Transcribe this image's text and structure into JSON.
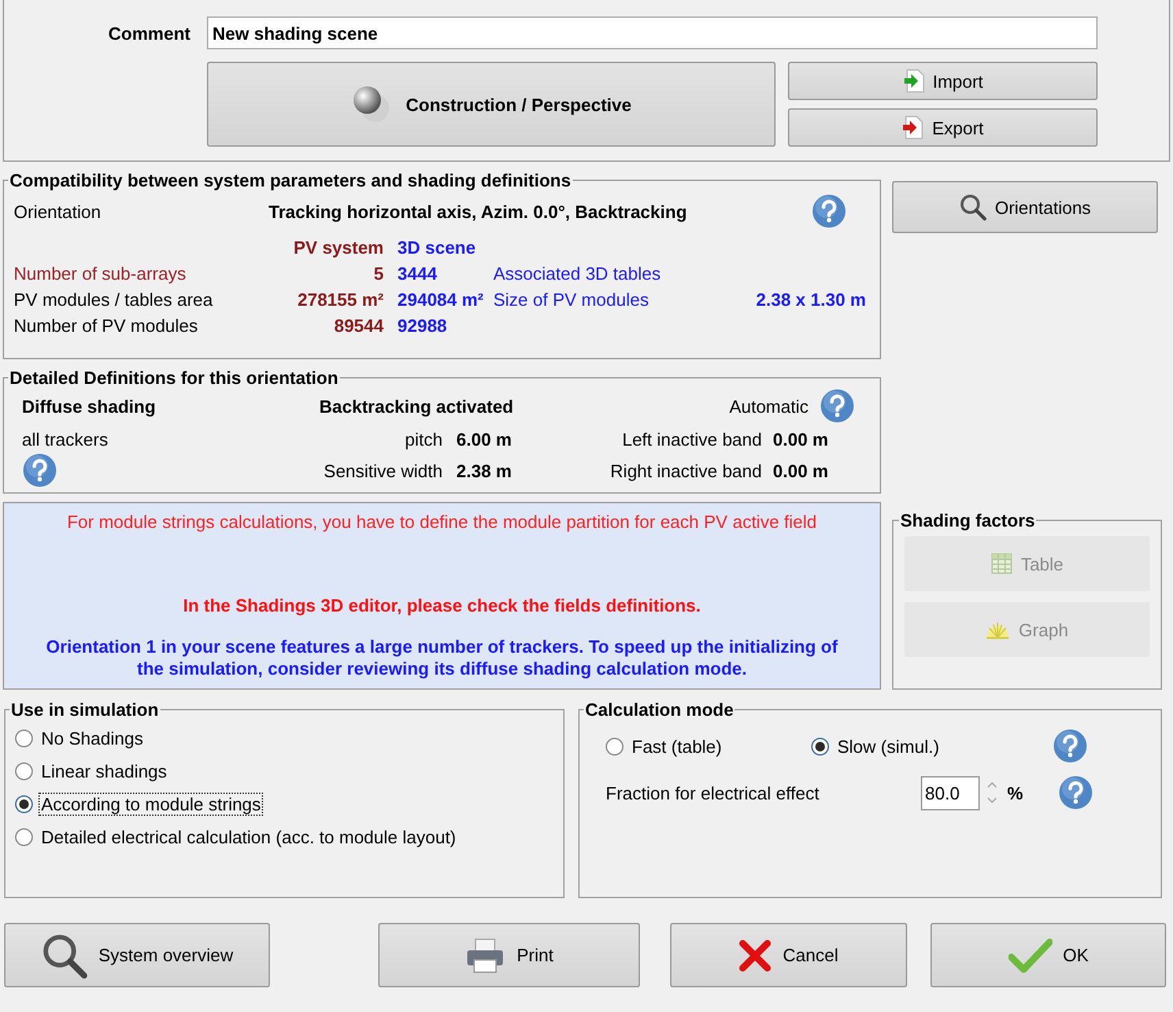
{
  "comment": {
    "label": "Comment",
    "value": "New shading scene"
  },
  "top_buttons": {
    "construction": "Construction / Perspective",
    "import": "Import",
    "export": "Export"
  },
  "compatibility": {
    "title": "Compatibility between system parameters and shading definitions",
    "orientation_label": "Orientation",
    "orientation_value": "Tracking horizontal axis, Azim. 0.0°, Backtracking",
    "col_pv": "PV system",
    "col_3d": "3D scene",
    "rows": [
      {
        "label": "Number of sub-arrays",
        "color": "#9b2226",
        "pv": "5",
        "scene": "3444",
        "extra_label": "Associated 3D tables",
        "extra_value": ""
      },
      {
        "label": "PV modules / tables area",
        "color": "#000000",
        "pv": "278155 m²",
        "scene": "294084 m²",
        "extra_label": "Size of PV modules",
        "extra_value": "2.38 x 1.30 m"
      },
      {
        "label": "Number of PV modules",
        "color": "#000000",
        "pv": "89544",
        "scene": "92988",
        "extra_label": "",
        "extra_value": ""
      }
    ]
  },
  "orientations_button": "Orientations",
  "detailed": {
    "title": "Detailed Definitions for this orientation",
    "diffuse_title": "Diffuse shading",
    "diffuse_value": "all trackers",
    "backtracking": "Backtracking activated",
    "automatic": "Automatic",
    "params": [
      {
        "label": "pitch",
        "value": "6.00 m",
        "label2": "Left inactive band",
        "value2": "0.00 m"
      },
      {
        "label": "Sensitive width",
        "value": "2.38 m",
        "label2": "Right inactive band",
        "value2": "0.00 m"
      }
    ]
  },
  "messages": [
    {
      "kind": "note",
      "text": "For module strings calculations, you have to define the module partition for each PV active field"
    },
    {
      "kind": "warning",
      "text": "In the Shadings 3D editor, please check the fields definitions."
    },
    {
      "kind": "advice",
      "text": "Orientation 1 in your scene features a large number of trackers. To speed up the initializing of the simulation, consider reviewing its diffuse shading calculation mode."
    }
  ],
  "shading_factors": {
    "title": "Shading factors",
    "buttons": [
      {
        "kind": "table",
        "label": "Table",
        "disabled": true
      },
      {
        "kind": "graph",
        "label": "Graph",
        "disabled": true
      }
    ]
  },
  "use_in_simulation": {
    "title": "Use in simulation",
    "options": [
      {
        "label": "No Shadings",
        "selected": false,
        "focused": false
      },
      {
        "label": "Linear shadings",
        "selected": false,
        "focused": false
      },
      {
        "label": "According to module strings",
        "selected": true,
        "focused": true
      },
      {
        "label": "Detailed electrical calculation (acc. to module layout)",
        "selected": false,
        "focused": false
      }
    ]
  },
  "calculation_mode": {
    "title": "Calculation mode",
    "options": [
      {
        "label": "Fast (table)",
        "selected": false
      },
      {
        "label": "Slow (simul.)",
        "selected": true
      }
    ],
    "fraction_label": "Fraction for electrical effect",
    "fraction_value": "80.0",
    "fraction_unit": "%"
  },
  "bottom_buttons": [
    {
      "kind": "overview",
      "label": "System overview"
    },
    {
      "kind": "print",
      "label": "Print"
    },
    {
      "kind": "cancel",
      "label": "Cancel"
    },
    {
      "kind": "ok",
      "label": "OK"
    }
  ]
}
